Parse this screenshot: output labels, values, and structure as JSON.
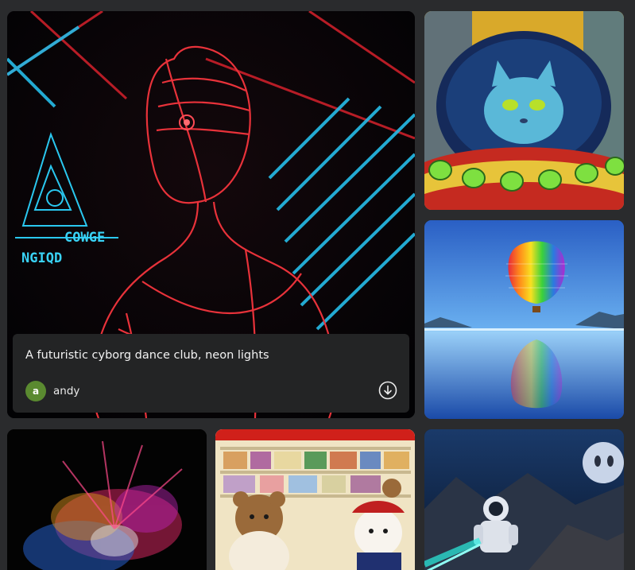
{
  "gallery": {
    "featured": {
      "title": "A futuristic cyborg dance club, neon lights",
      "author": {
        "initial": "a",
        "name": "andy",
        "avatar_color": "#5a8a30"
      },
      "artwork_text": "COWGE",
      "artwork_text_2": "NGIQD",
      "actions": {
        "download_icon": "download-icon"
      }
    },
    "colors": {
      "background": "#2a2b2d",
      "caption_background": "#232425",
      "neon_red": "#e8323a",
      "neon_cyan": "#2ac8f0"
    }
  }
}
